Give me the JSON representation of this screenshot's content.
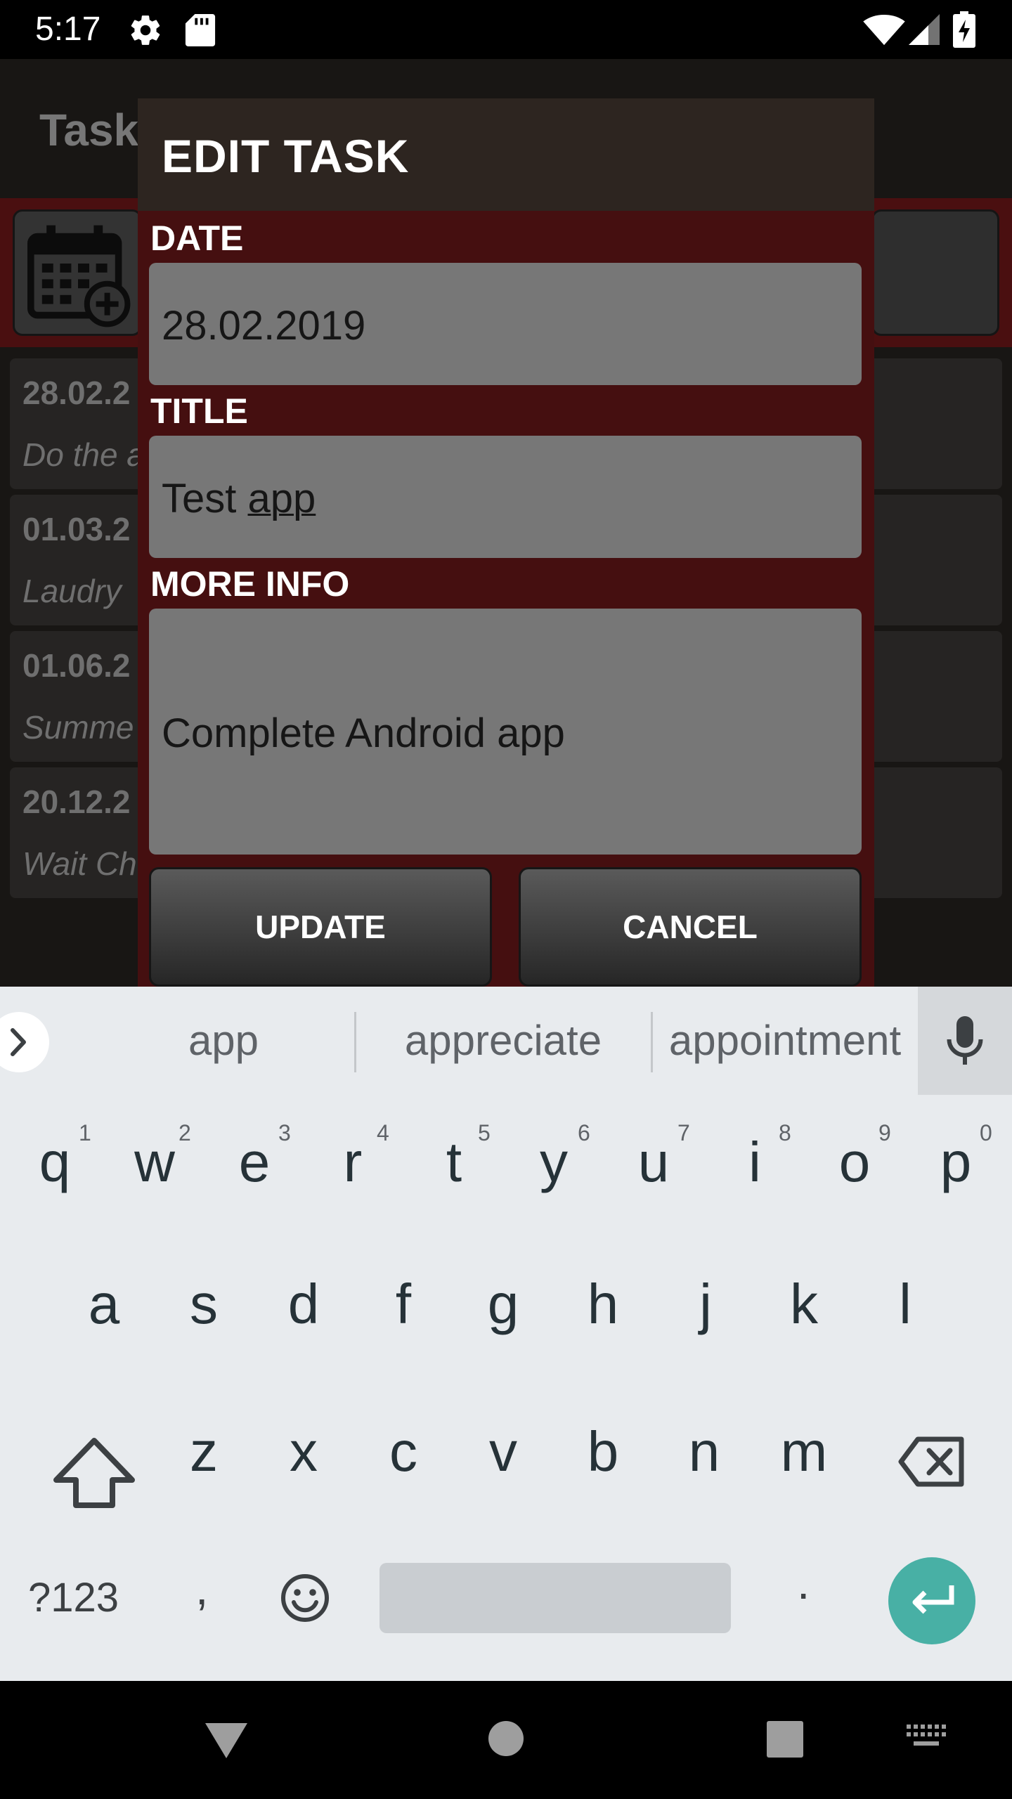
{
  "status_bar": {
    "time": "5:17",
    "icons": [
      "gear-icon",
      "sd-card-icon",
      "wifi-icon",
      "cell-signal-icon",
      "battery-charging-icon"
    ]
  },
  "app": {
    "title": "Task",
    "task_list": [
      {
        "date": "28.02.2",
        "title": "Do the a"
      },
      {
        "date": "01.03.2",
        "title": "Laudry"
      },
      {
        "date": "01.06.2",
        "title": "Summe"
      },
      {
        "date": "20.12.2",
        "title": "Wait Ch"
      }
    ]
  },
  "dialog": {
    "title": "EDIT TASK",
    "date_label": "DATE",
    "date_value": "28.02.2019",
    "title_label": "TITLE",
    "title_value_plain": "Test ",
    "title_value_underlined": "app",
    "info_label": "MORE INFO",
    "info_value": "Complete Android app",
    "update_label": "UPDATE",
    "cancel_label": "CANCEL"
  },
  "keyboard": {
    "suggestions": [
      "app",
      "appreciate",
      "appointment"
    ],
    "row1": [
      {
        "ch": "q",
        "hint": "1"
      },
      {
        "ch": "w",
        "hint": "2"
      },
      {
        "ch": "e",
        "hint": "3"
      },
      {
        "ch": "r",
        "hint": "4"
      },
      {
        "ch": "t",
        "hint": "5"
      },
      {
        "ch": "y",
        "hint": "6"
      },
      {
        "ch": "u",
        "hint": "7"
      },
      {
        "ch": "i",
        "hint": "8"
      },
      {
        "ch": "o",
        "hint": "9"
      },
      {
        "ch": "p",
        "hint": "0"
      }
    ],
    "row2": [
      "a",
      "s",
      "d",
      "f",
      "g",
      "h",
      "j",
      "k",
      "l"
    ],
    "row3": [
      "z",
      "x",
      "c",
      "v",
      "b",
      "n",
      "m"
    ],
    "symbols_label": "?123",
    "comma_label": ",",
    "period_label": "."
  },
  "colors": {
    "dialog_body": "#450f10",
    "dialog_header": "#2d2520",
    "field_bg": "#777777",
    "enter_key": "#48b0a5",
    "keyboard_bg": "#e8ebee"
  }
}
